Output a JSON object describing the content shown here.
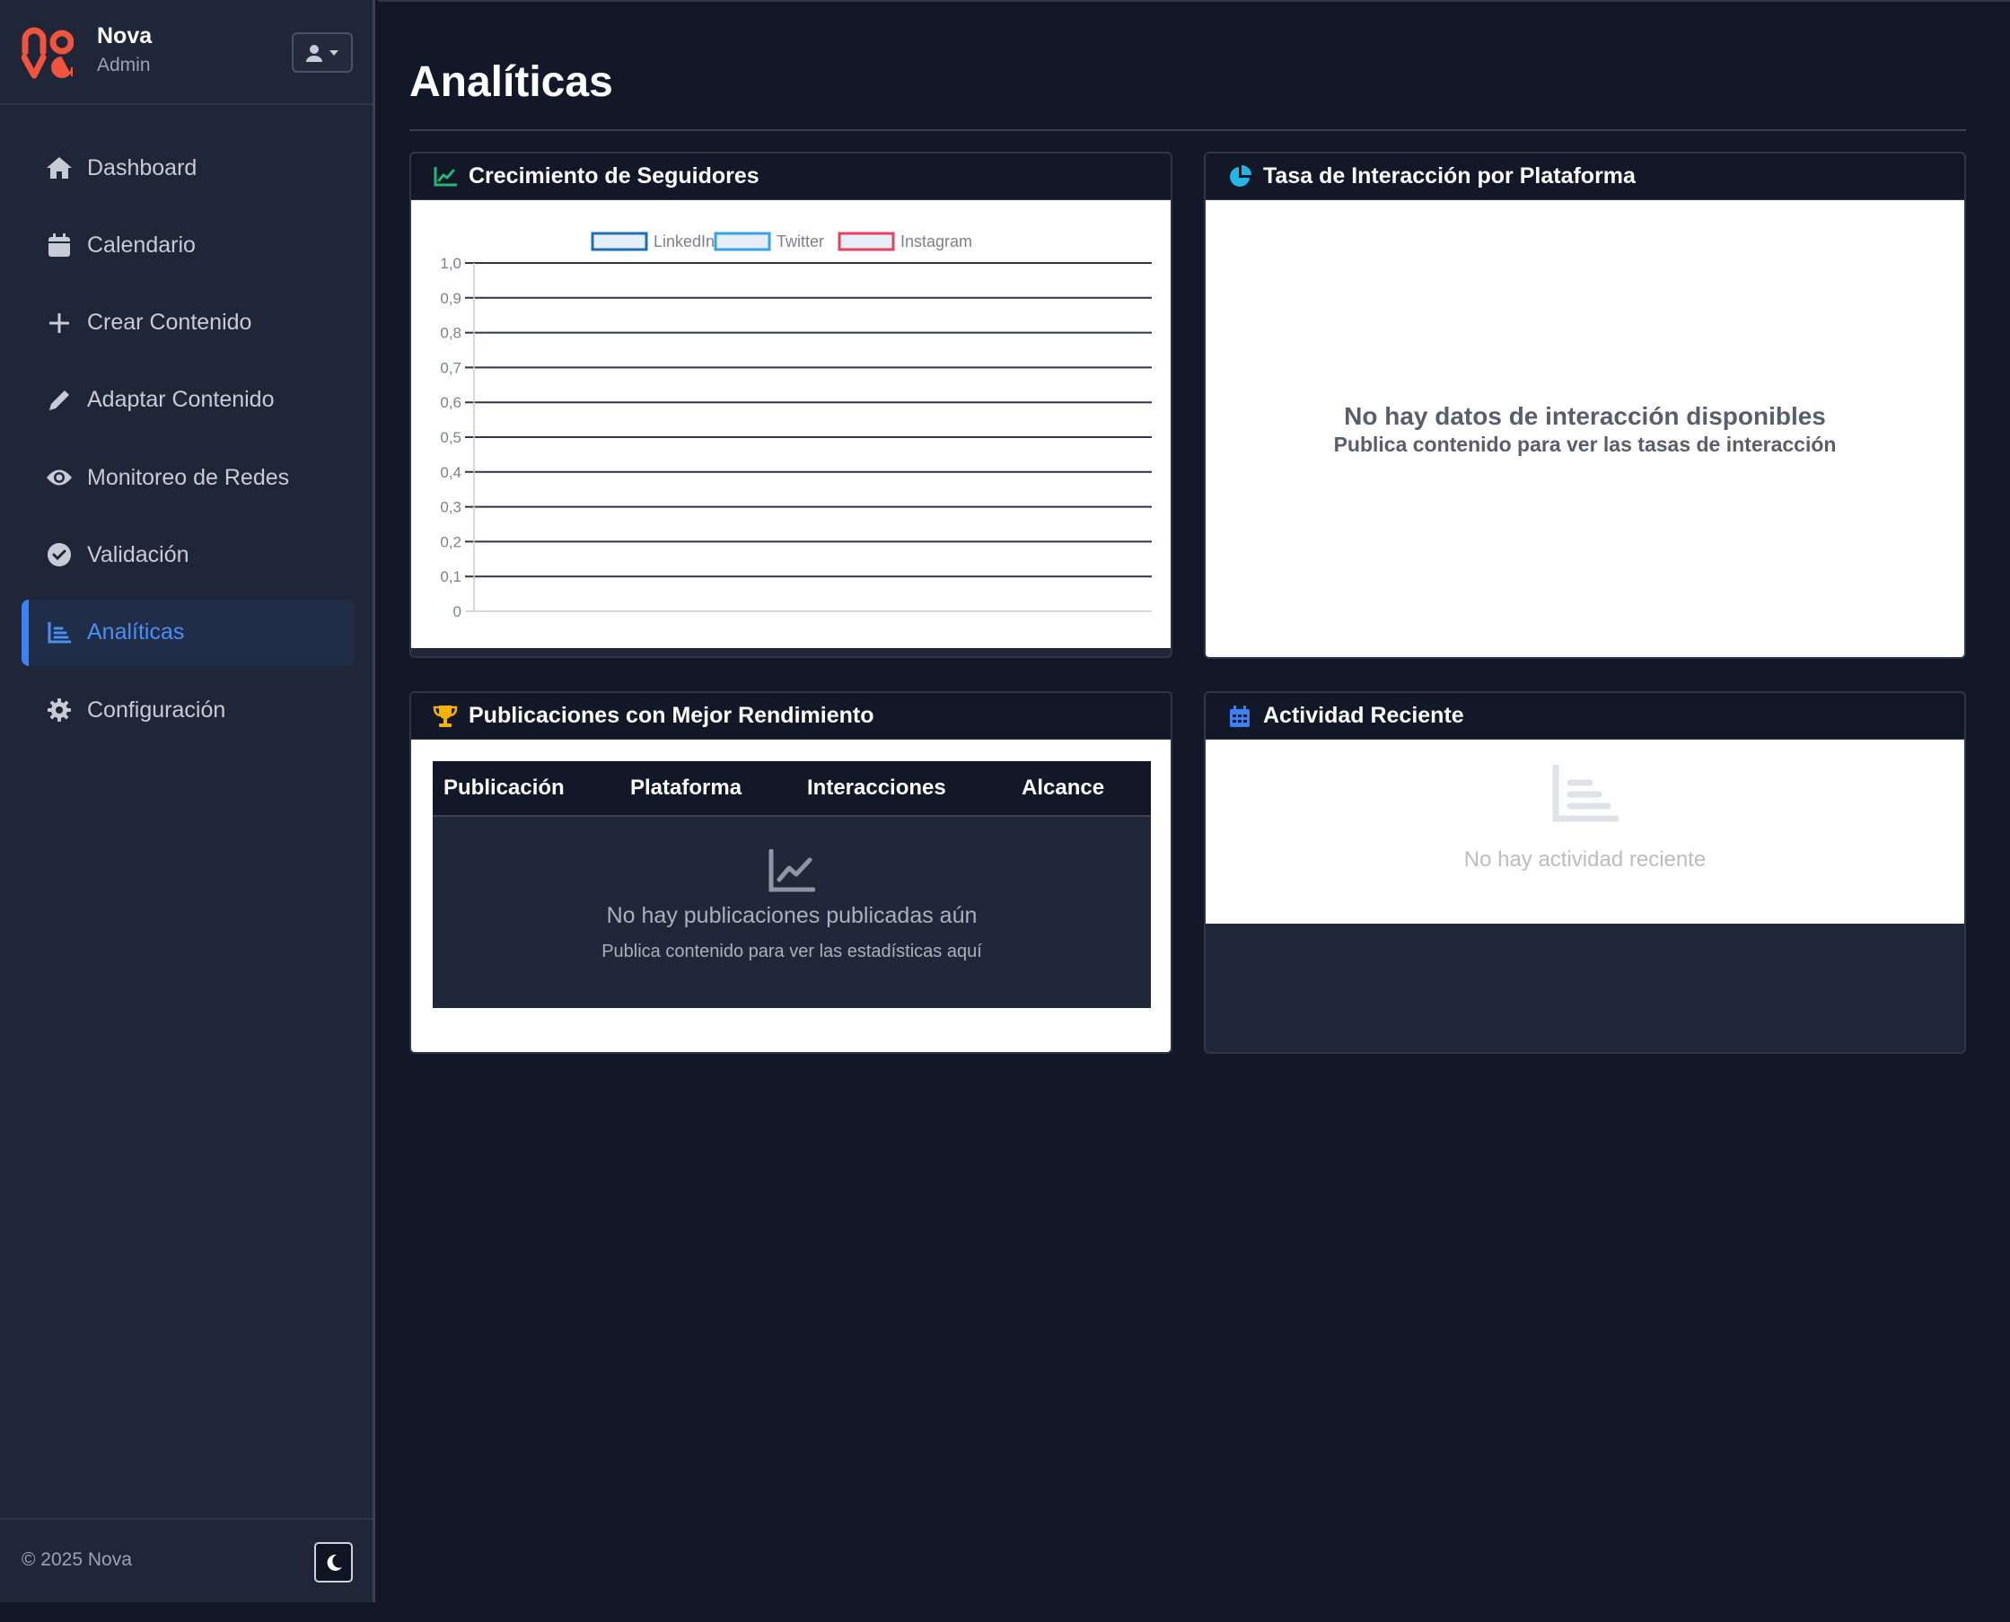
{
  "brand": {
    "name": "Nova",
    "role": "Admin",
    "logo_letters": "nova"
  },
  "sidebar": {
    "items": [
      {
        "label": "Dashboard",
        "icon": "home-icon",
        "active": false
      },
      {
        "label": "Calendario",
        "icon": "calendar-icon",
        "active": false
      },
      {
        "label": "Crear Contenido",
        "icon": "plus-icon",
        "active": false
      },
      {
        "label": "Adaptar Contenido",
        "icon": "pencil-icon",
        "active": false
      },
      {
        "label": "Monitoreo de Redes",
        "icon": "eye-icon",
        "active": false
      },
      {
        "label": "Validación",
        "icon": "check-circle-icon",
        "active": false
      },
      {
        "label": "Analíticas",
        "icon": "list-chart-icon",
        "active": true
      },
      {
        "label": "Configuración",
        "icon": "gear-icon",
        "active": false
      }
    ],
    "footer": {
      "copyright": "© 2025 Nova"
    }
  },
  "page": {
    "title": "Analíticas"
  },
  "cards": {
    "followers": {
      "title": "Crecimiento de Seguidores"
    },
    "interaction": {
      "title": "Tasa de Interacción por Plataforma",
      "empty_title": "No hay datos de interacción disponibles",
      "empty_subtitle": "Publica contenido para ver las tasas de interacción"
    },
    "top_posts": {
      "title": "Publicaciones con Mejor Rendimiento",
      "columns": [
        "Publicación",
        "Plataforma",
        "Interacciones",
        "Alcance"
      ],
      "empty_title": "No hay publicaciones publicadas aún",
      "empty_subtitle": "Publica contenido para ver las estadísticas aquí"
    },
    "activity": {
      "title": "Actividad Reciente",
      "empty_text": "No hay actividad reciente"
    }
  },
  "chart_data": {
    "type": "line",
    "series": [
      {
        "name": "LinkedIn",
        "values": [],
        "color": "#1f6fb2"
      },
      {
        "name": "Twitter",
        "values": [],
        "color": "#36a2eb"
      },
      {
        "name": "Instagram",
        "values": [],
        "color": "#e4405f"
      }
    ],
    "x": [],
    "y_ticks": [
      "1,0",
      "0,9",
      "0,8",
      "0,7",
      "0,6",
      "0,5",
      "0,4",
      "0,3",
      "0,2",
      "0,1",
      "0"
    ],
    "ylim": [
      0,
      1
    ],
    "grid": true,
    "legend": "top-center"
  },
  "colors": {
    "accent": "#3b82f6",
    "background": "#121828",
    "sidebar": "#1f2637",
    "logo": "#f0533e"
  }
}
